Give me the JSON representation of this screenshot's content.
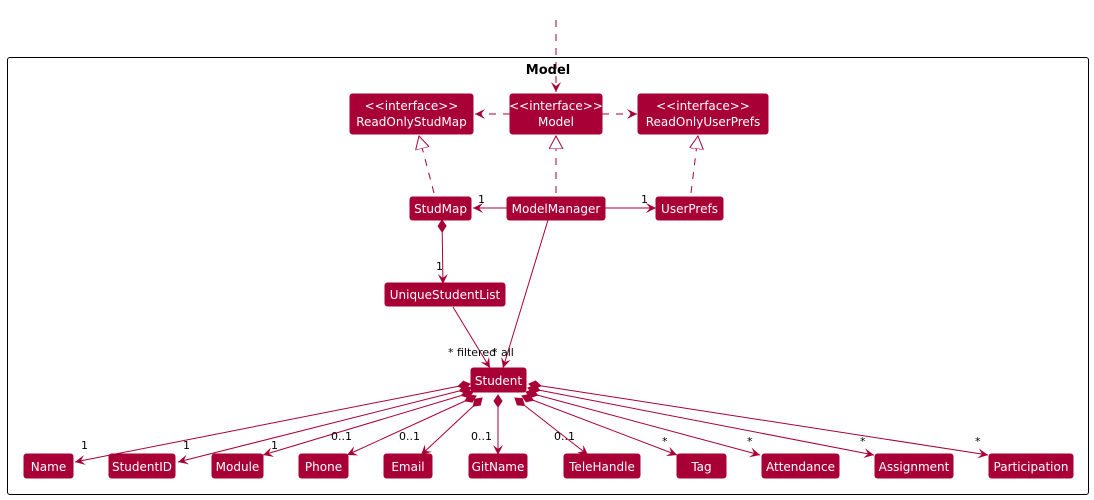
{
  "package": {
    "title": "Model"
  },
  "colors": {
    "node_fill": "#A80036",
    "node_text": "#FFFFFF",
    "edge": "#A80036",
    "frame": "#000000"
  },
  "nodes": {
    "readOnlyStudMap": {
      "stereotype": "<<interface>>",
      "name": "ReadOnlyStudMap"
    },
    "model": {
      "stereotype": "<<interface>>",
      "name": "Model"
    },
    "readOnlyUserPrefs": {
      "stereotype": "<<interface>>",
      "name": "ReadOnlyUserPrefs"
    },
    "studMap": {
      "name": "StudMap"
    },
    "modelManager": {
      "name": "ModelManager"
    },
    "userPrefs": {
      "name": "UserPrefs"
    },
    "uniqueStudentList": {
      "name": "UniqueStudentList"
    },
    "student": {
      "name": "Student"
    },
    "name": {
      "name": "Name"
    },
    "studentId": {
      "name": "StudentID"
    },
    "module": {
      "name": "Module"
    },
    "phone": {
      "name": "Phone"
    },
    "email": {
      "name": "Email"
    },
    "gitName": {
      "name": "GitName"
    },
    "teleHandle": {
      "name": "TeleHandle"
    },
    "tag": {
      "name": "Tag"
    },
    "attendance": {
      "name": "Attendance"
    },
    "assignment": {
      "name": "Assignment"
    },
    "participation": {
      "name": "Participation"
    }
  },
  "multiplicities": {
    "mm_studmap": "1",
    "mm_userprefs": "1",
    "studmap_list": "1",
    "filtered": "* filtered",
    "all": "* all",
    "name": "1",
    "studentId": "1",
    "module": "1",
    "phone": "0..1",
    "email": "0..1",
    "gitName": "0..1",
    "teleHandle": "0..1",
    "tag": "*",
    "attendance": "*",
    "assignment": "*",
    "participation": "*"
  }
}
